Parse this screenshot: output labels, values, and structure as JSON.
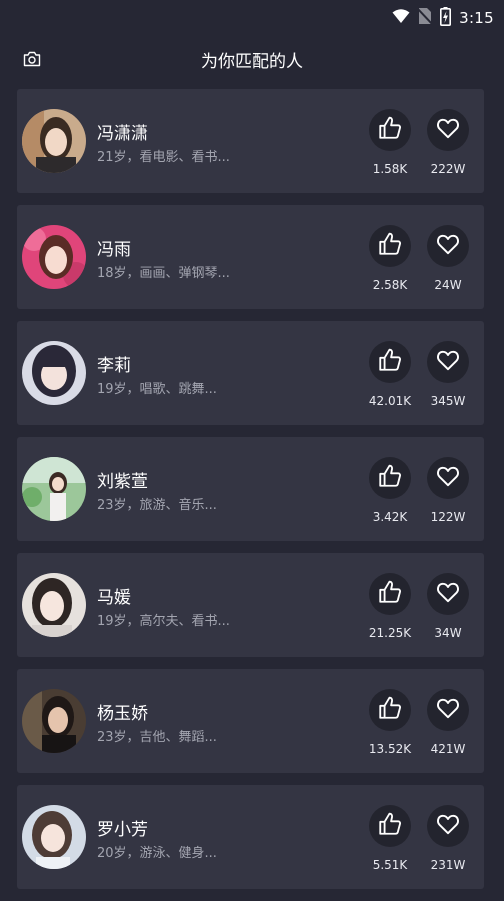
{
  "status_bar": {
    "time": "3:15",
    "icons": [
      "wifi-icon",
      "no-sim-icon",
      "battery-charging-icon"
    ]
  },
  "header": {
    "title": "为你匹配的人",
    "left_icon": "camera-icon"
  },
  "colors": {
    "background": "#262734",
    "card": "#343543",
    "button_circle": "#23242e",
    "secondary_text": "#a3a5b0"
  },
  "people": [
    {
      "name": "冯潇潇",
      "desc": "21岁，看电影、看书...",
      "likes": "1.58K",
      "favs": "222W"
    },
    {
      "name": "冯雨",
      "desc": "18岁，画画、弹钢琴...",
      "likes": "2.58K",
      "favs": "24W"
    },
    {
      "name": "李莉",
      "desc": "19岁，唱歌、跳舞...",
      "likes": "42.01K",
      "favs": "345W"
    },
    {
      "name": "刘紫萱",
      "desc": "23岁，旅游、音乐...",
      "likes": "3.42K",
      "favs": "122W"
    },
    {
      "name": "马媛",
      "desc": "19岁，高尔夫、看书...",
      "likes": "21.25K",
      "favs": "34W"
    },
    {
      "name": "杨玉娇",
      "desc": "23岁，吉他、舞蹈...",
      "likes": "13.52K",
      "favs": "421W"
    },
    {
      "name": "罗小芳",
      "desc": "20岁，游泳、健身...",
      "likes": "5.51K",
      "favs": "231W"
    }
  ],
  "icons": {
    "like": "thumbs-up-icon",
    "favorite": "heart-icon"
  }
}
